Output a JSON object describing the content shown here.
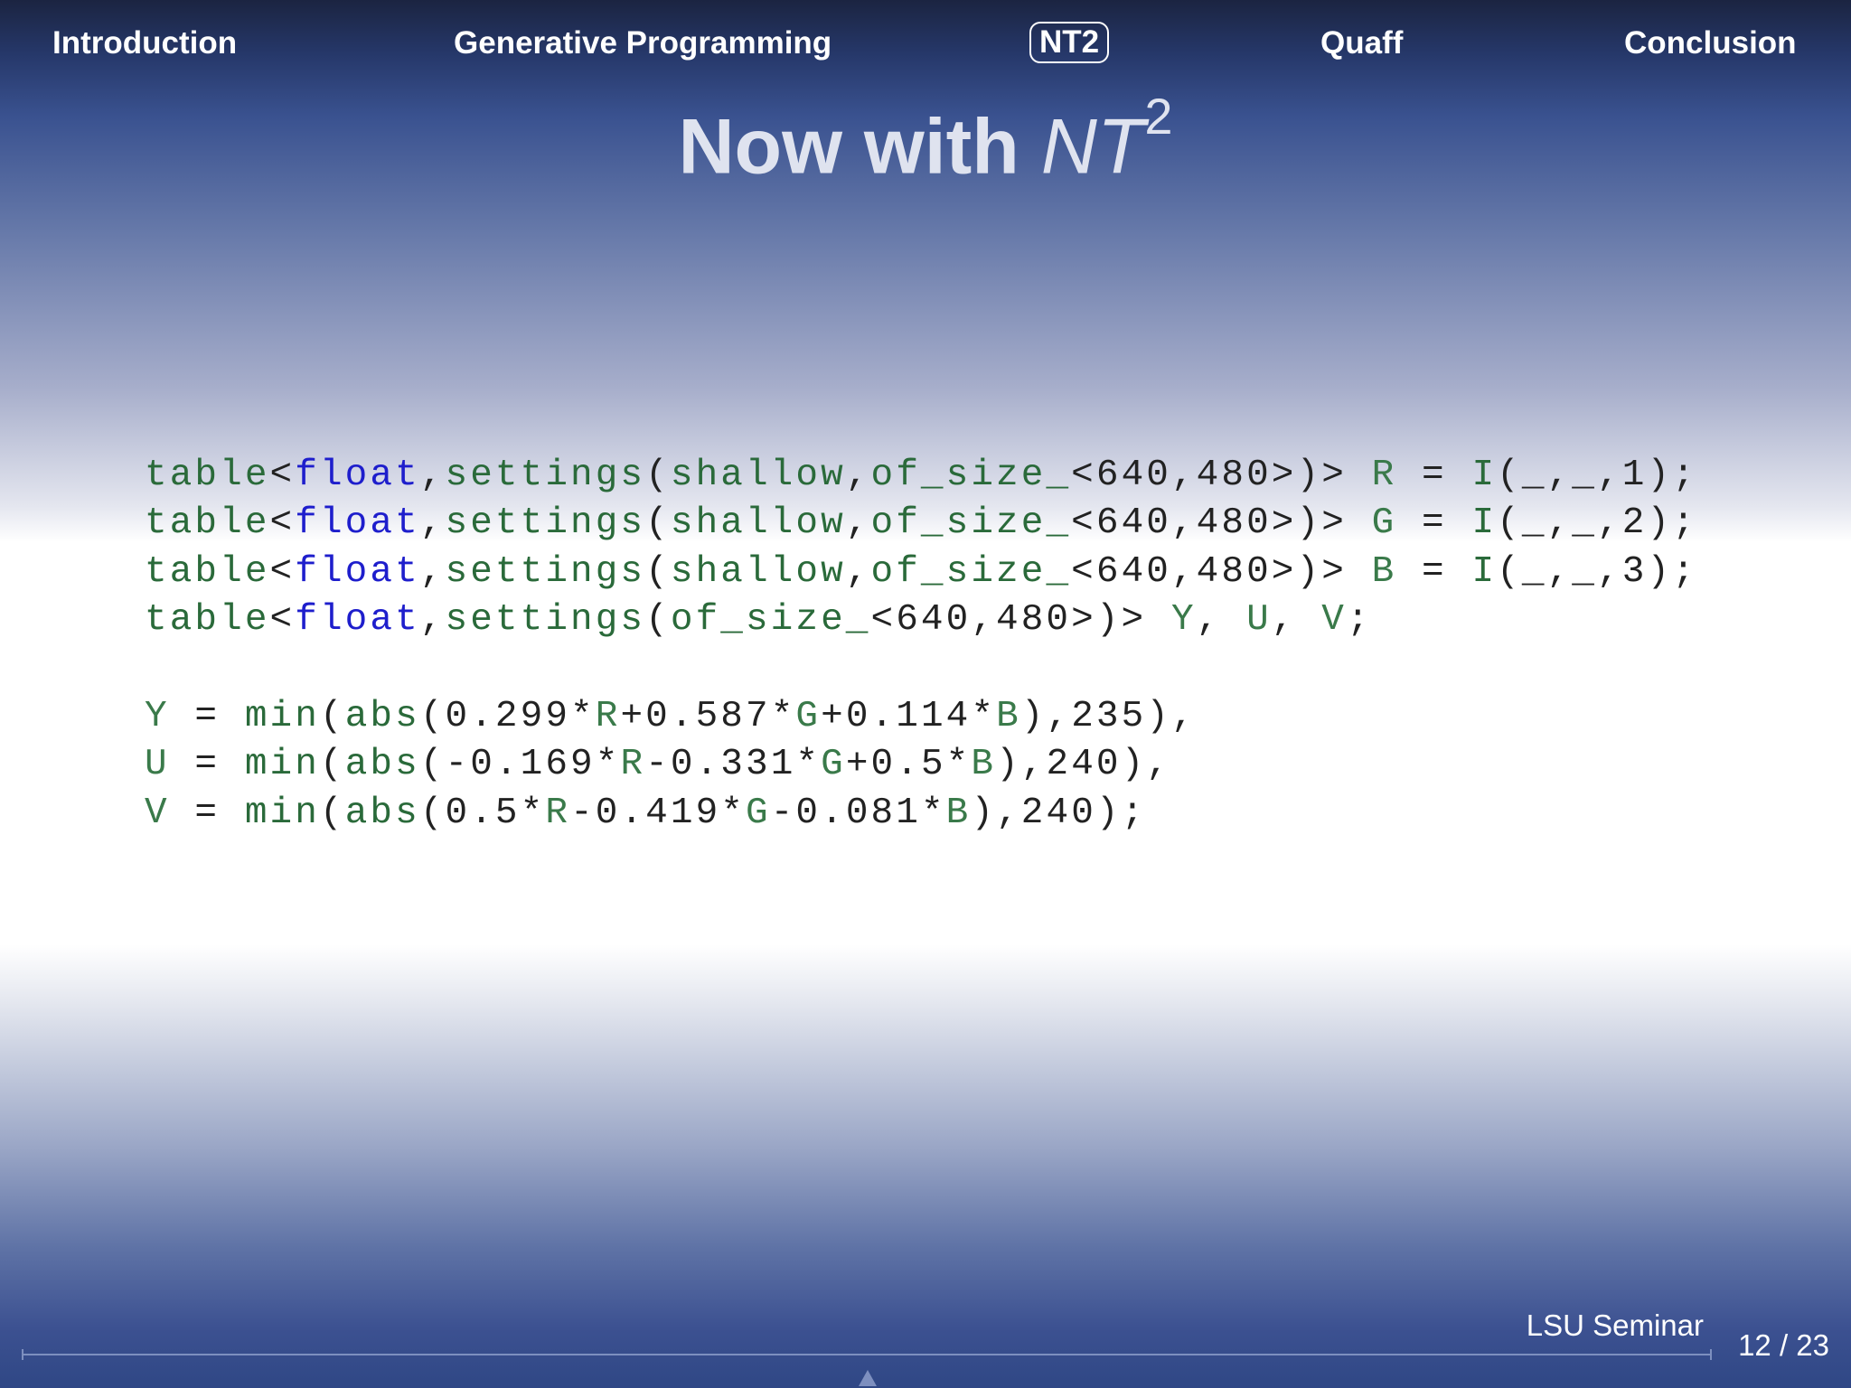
{
  "nav": {
    "items": [
      {
        "label": "Introduction",
        "active": false
      },
      {
        "label": "Generative Programming",
        "active": false
      },
      {
        "label": "NT2",
        "active": true
      },
      {
        "label": "Quaff",
        "active": false
      },
      {
        "label": "Conclusion",
        "active": false
      }
    ]
  },
  "title": {
    "text": "Now with ",
    "italic": "NT",
    "sup": "2"
  },
  "code": {
    "lines": [
      [
        [
          "type",
          "table"
        ],
        [
          "pl",
          "<"
        ],
        [
          "kw",
          "float"
        ],
        [
          "pl",
          ","
        ],
        [
          "type",
          "settings"
        ],
        [
          "pl",
          "("
        ],
        [
          "type",
          "shallow"
        ],
        [
          "pl",
          ","
        ],
        [
          "type",
          "of_size_"
        ],
        [
          "pl",
          "<640,480>)> "
        ],
        [
          "var",
          "R"
        ],
        [
          "pl",
          " = "
        ],
        [
          "type",
          "I"
        ],
        [
          "pl",
          "(_,_,1);"
        ]
      ],
      [
        [
          "type",
          "table"
        ],
        [
          "pl",
          "<"
        ],
        [
          "kw",
          "float"
        ],
        [
          "pl",
          ","
        ],
        [
          "type",
          "settings"
        ],
        [
          "pl",
          "("
        ],
        [
          "type",
          "shallow"
        ],
        [
          "pl",
          ","
        ],
        [
          "type",
          "of_size_"
        ],
        [
          "pl",
          "<640,480>)> "
        ],
        [
          "var",
          "G"
        ],
        [
          "pl",
          " = "
        ],
        [
          "type",
          "I"
        ],
        [
          "pl",
          "(_,_,2);"
        ]
      ],
      [
        [
          "type",
          "table"
        ],
        [
          "pl",
          "<"
        ],
        [
          "kw",
          "float"
        ],
        [
          "pl",
          ","
        ],
        [
          "type",
          "settings"
        ],
        [
          "pl",
          "("
        ],
        [
          "type",
          "shallow"
        ],
        [
          "pl",
          ","
        ],
        [
          "type",
          "of_size_"
        ],
        [
          "pl",
          "<640,480>)> "
        ],
        [
          "var",
          "B"
        ],
        [
          "pl",
          " = "
        ],
        [
          "type",
          "I"
        ],
        [
          "pl",
          "(_,_,3);"
        ]
      ],
      [
        [
          "type",
          "table"
        ],
        [
          "pl",
          "<"
        ],
        [
          "kw",
          "float"
        ],
        [
          "pl",
          ","
        ],
        [
          "type",
          "settings"
        ],
        [
          "pl",
          "("
        ],
        [
          "type",
          "of_size_"
        ],
        [
          "pl",
          "<640,480>)> "
        ],
        [
          "var",
          "Y"
        ],
        [
          "pl",
          ", "
        ],
        [
          "var",
          "U"
        ],
        [
          "pl",
          ", "
        ],
        [
          "var",
          "V"
        ],
        [
          "pl",
          ";"
        ]
      ],
      [],
      [
        [
          "var",
          "Y"
        ],
        [
          "pl",
          " = "
        ],
        [
          "type",
          "min"
        ],
        [
          "pl",
          "("
        ],
        [
          "type",
          "abs"
        ],
        [
          "pl",
          "(0.299*"
        ],
        [
          "var",
          "R"
        ],
        [
          "pl",
          "+0.587*"
        ],
        [
          "var",
          "G"
        ],
        [
          "pl",
          "+0.114*"
        ],
        [
          "var",
          "B"
        ],
        [
          "pl",
          "),235),"
        ]
      ],
      [
        [
          "var",
          "U"
        ],
        [
          "pl",
          " = "
        ],
        [
          "type",
          "min"
        ],
        [
          "pl",
          "("
        ],
        [
          "type",
          "abs"
        ],
        [
          "pl",
          "(-0.169*"
        ],
        [
          "var",
          "R"
        ],
        [
          "pl",
          "-0.331*"
        ],
        [
          "var",
          "G"
        ],
        [
          "pl",
          "+0.5*"
        ],
        [
          "var",
          "B"
        ],
        [
          "pl",
          "),240),"
        ]
      ],
      [
        [
          "var",
          "V"
        ],
        [
          "pl",
          " = "
        ],
        [
          "type",
          "min"
        ],
        [
          "pl",
          "("
        ],
        [
          "type",
          "abs"
        ],
        [
          "pl",
          "(0.5*"
        ],
        [
          "var",
          "R"
        ],
        [
          "pl",
          "-0.419*"
        ],
        [
          "var",
          "G"
        ],
        [
          "pl",
          "-0.081*"
        ],
        [
          "var",
          "B"
        ],
        [
          "pl",
          "),240);"
        ]
      ]
    ]
  },
  "footer": {
    "author": "LSU Seminar",
    "page": "12 / 23"
  },
  "colors": {
    "code_type": "#2a6a3a",
    "code_keyword": "#1e1ecc",
    "code_variable": "#3a7a4a",
    "code_plain": "#222222"
  }
}
